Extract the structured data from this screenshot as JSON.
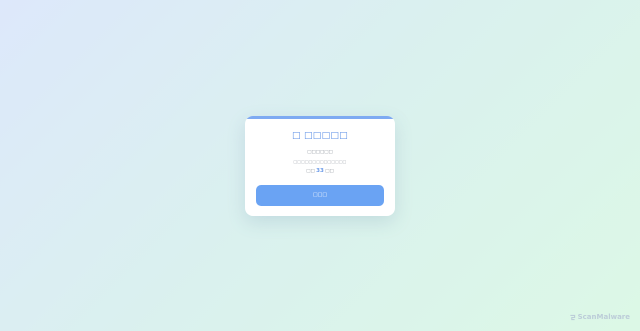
{
  "card": {
    "title": "□ □□□□□",
    "message_line1": "□□□□□□",
    "message_line2": "□□□□□□□□□□□□□□",
    "countdown_prefix": "□□",
    "countdown_value": "33",
    "countdown_suffix": "□□",
    "button_label": "□□□"
  },
  "watermark": {
    "text": "ScanMalware",
    "icon": "logo-icon"
  },
  "colors": {
    "accent": "#6aa3f3",
    "title": "#5b8fe6",
    "top_bar": "#7eaaf2"
  }
}
